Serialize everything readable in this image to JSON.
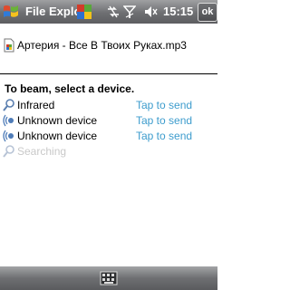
{
  "titlebar": {
    "app_title": "File Explorer",
    "clock": "15:15",
    "ok_label": "ok",
    "icons": [
      "start-icon",
      "multitask-icon",
      "connectivity-icon",
      "signal-icon",
      "volume-icon"
    ]
  },
  "file": {
    "name": "Артерия - Все В Твоих Руках.mp3",
    "icon": "audio-file-icon"
  },
  "beam": {
    "instruction": "To beam, select a device.",
    "devices": [
      {
        "name": "Infrared",
        "action": "Tap to send",
        "icon": "search-icon"
      },
      {
        "name": "Unknown device",
        "action": "Tap to send",
        "icon": "bluetooth-wave-icon"
      },
      {
        "name": "Unknown device",
        "action": "Tap to send",
        "icon": "bluetooth-wave-icon"
      }
    ],
    "searching_label": "Searching"
  },
  "bottombar": {
    "icon": "keyboard-icon"
  },
  "colors": {
    "bar": "#6e6f72",
    "link": "#3d9ccd",
    "disabled": "#c9c9c9"
  }
}
